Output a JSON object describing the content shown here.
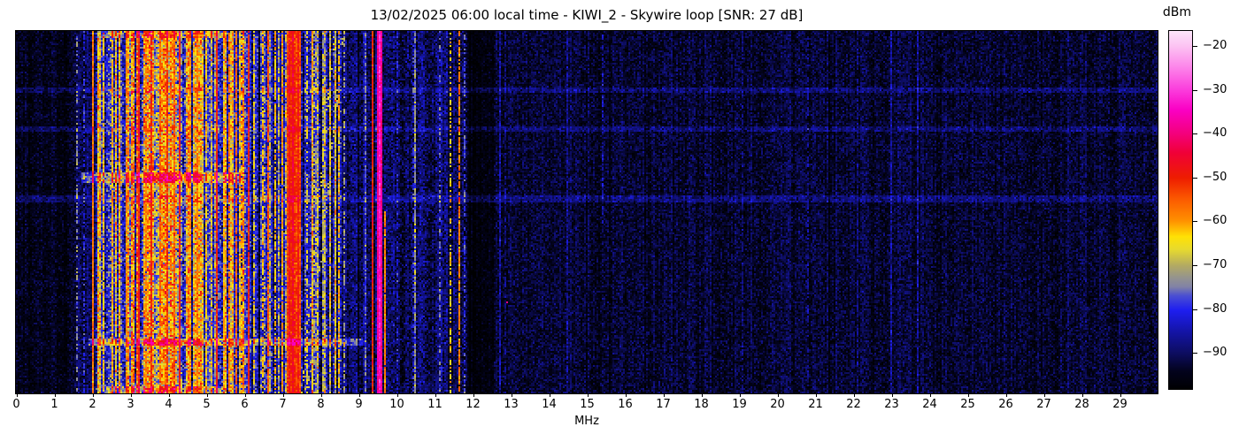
{
  "figure": {
    "background": "#ffffff",
    "text_color": "#000000"
  },
  "header": {
    "title": "13/02/2025 06:00 local time - KIWI_2 - Skywire loop [SNR: 27 dB]",
    "date": "13/02/2025",
    "time": "06:00 local time",
    "station": "KIWI_2",
    "antenna": "Skywire loop",
    "snr": "27 dB"
  },
  "x_axis": {
    "label": "MHz",
    "range_mhz": [
      0,
      30.02
    ],
    "ticks": [
      {
        "v": 0,
        "label": "0"
      },
      {
        "v": 1,
        "label": "1"
      },
      {
        "v": 2,
        "label": "2"
      },
      {
        "v": 3,
        "label": "3"
      },
      {
        "v": 4,
        "label": "4"
      },
      {
        "v": 5,
        "label": "5"
      },
      {
        "v": 6,
        "label": "6"
      },
      {
        "v": 7,
        "label": "7"
      },
      {
        "v": 8,
        "label": "8"
      },
      {
        "v": 9,
        "label": "9"
      },
      {
        "v": 10,
        "label": "10"
      },
      {
        "v": 11,
        "label": "11"
      },
      {
        "v": 12,
        "label": "12"
      },
      {
        "v": 13,
        "label": "13"
      },
      {
        "v": 14,
        "label": "14"
      },
      {
        "v": 15,
        "label": "15"
      },
      {
        "v": 16,
        "label": "16"
      },
      {
        "v": 17,
        "label": "17"
      },
      {
        "v": 18,
        "label": "18"
      },
      {
        "v": 19,
        "label": "19"
      },
      {
        "v": 20,
        "label": "20"
      },
      {
        "v": 21,
        "label": "21"
      },
      {
        "v": 22,
        "label": "22"
      },
      {
        "v": 23,
        "label": "23"
      },
      {
        "v": 24,
        "label": "24"
      },
      {
        "v": 25,
        "label": "25"
      },
      {
        "v": 26,
        "label": "26"
      },
      {
        "v": 27,
        "label": "27"
      },
      {
        "v": 28,
        "label": "28"
      },
      {
        "v": 29,
        "label": "29"
      }
    ]
  },
  "colorbar": {
    "label": "dBm",
    "vmin": -98.2,
    "vmax": -16.6,
    "ticks": [
      {
        "v": -20,
        "label": "−20"
      },
      {
        "v": -30,
        "label": "−30"
      },
      {
        "v": -40,
        "label": "−40"
      },
      {
        "v": -50,
        "label": "−50"
      },
      {
        "v": -60,
        "label": "−60"
      },
      {
        "v": -70,
        "label": "−70"
      },
      {
        "v": -80,
        "label": "−80"
      },
      {
        "v": -90,
        "label": "−90"
      }
    ]
  },
  "chart_data": {
    "type": "heatmap",
    "title": "13/02/2025 06:00 local time - KIWI_2 - Skywire loop [SNR: 27 dB]",
    "xlabel": "MHz",
    "x_range_mhz": [
      0,
      30.02
    ],
    "y_axis": "time (waterfall rows, unlabeled)",
    "value_unit": "dBm",
    "value_range_dbm": [
      -98.2,
      -16.6
    ],
    "grid": false,
    "legend": "colorbar right, dBm −20 to −90",
    "colormap_stops": [
      [
        0.0,
        "#000002"
      ],
      [
        0.05,
        "#03031d"
      ],
      [
        0.1,
        "#0d0d60"
      ],
      [
        0.16,
        "#1414a6"
      ],
      [
        0.22,
        "#1e1ef0"
      ],
      [
        0.26,
        "#4a4ed2"
      ],
      [
        0.285,
        "#8182a6"
      ],
      [
        0.31,
        "#94938f"
      ],
      [
        0.345,
        "#b3aa62"
      ],
      [
        0.39,
        "#e7da2e"
      ],
      [
        0.425,
        "#ffe105"
      ],
      [
        0.47,
        "#ff9000"
      ],
      [
        0.53,
        "#fb5a00"
      ],
      [
        0.59,
        "#ee1c00"
      ],
      [
        0.66,
        "#f00038"
      ],
      [
        0.715,
        "#f4007e"
      ],
      [
        0.78,
        "#fa00c4"
      ],
      [
        0.835,
        "#fb3cdc"
      ],
      [
        0.9,
        "#fc86ea"
      ],
      [
        0.955,
        "#fcc0f2"
      ],
      [
        1.0,
        "#fde6fa"
      ]
    ],
    "band_format": [
      "f0_mhz",
      "f1_mhz",
      "mean_dbm",
      "col_sd",
      "px_sd",
      "hot_prob",
      "hot_mean_dbm",
      "hot_sd"
    ],
    "noise_bands": [
      [
        0.0,
        1.5,
        -95.0,
        1.0,
        2.2,
        0,
        0,
        0
      ],
      [
        1.5,
        2.05,
        -92.0,
        2.0,
        3.0,
        0.1,
        -80,
        4
      ],
      [
        2.05,
        3.0,
        -80.0,
        4.0,
        5.0,
        0.45,
        -67,
        5
      ],
      [
        3.0,
        4.6,
        -76.0,
        5.0,
        5.5,
        0.65,
        -62,
        6
      ],
      [
        4.6,
        5.55,
        -79.0,
        4.0,
        5.0,
        0.5,
        -65,
        5
      ],
      [
        5.55,
        8.55,
        -85.0,
        4.5,
        4.5,
        0.27,
        -68,
        5
      ],
      [
        8.55,
        11.85,
        -90.5,
        2.5,
        3.5,
        0.05,
        -76,
        3
      ],
      [
        11.85,
        12.55,
        -96.5,
        1.0,
        1.8,
        0,
        0,
        0
      ],
      [
        12.55,
        30.1,
        -93.2,
        1.2,
        2.6,
        0.012,
        -88,
        2
      ]
    ],
    "line_format": [
      "freq_mhz",
      "level_dbm",
      "dash_fraction",
      "halfwidth_cells",
      "y_start_frac",
      "y_end_frac"
    ],
    "signal_lines": [
      [
        1.56,
        -74,
        0.5,
        0,
        0,
        1
      ],
      [
        1.78,
        -80,
        0.5,
        0,
        0,
        1
      ],
      [
        2.0,
        -57,
        1,
        0,
        0,
        1
      ],
      [
        2.3,
        -63,
        0.8,
        0,
        0,
        1
      ],
      [
        2.5,
        -61,
        0.9,
        0,
        0,
        1
      ],
      [
        2.72,
        -64,
        0.7,
        0,
        0,
        1
      ],
      [
        2.9,
        -59,
        0.9,
        0,
        0,
        1
      ],
      [
        3.2,
        -52,
        0.95,
        0,
        0,
        1
      ],
      [
        3.4,
        -58,
        0.9,
        0,
        0,
        1
      ],
      [
        3.55,
        -50,
        0.95,
        0,
        0,
        1
      ],
      [
        3.75,
        -55,
        0.9,
        0,
        0,
        1
      ],
      [
        3.95,
        -52,
        0.95,
        0,
        0,
        1
      ],
      [
        4.15,
        -57,
        0.9,
        0,
        0,
        1
      ],
      [
        4.3,
        -50,
        0.95,
        0,
        0,
        1
      ],
      [
        4.55,
        -60,
        0.85,
        0,
        0,
        1
      ],
      [
        4.75,
        -58,
        0.9,
        0,
        0,
        1
      ],
      [
        5.0,
        -63,
        0.8,
        0,
        0,
        1
      ],
      [
        5.28,
        -50,
        0.95,
        0,
        0,
        1
      ],
      [
        5.45,
        -62,
        0.8,
        0,
        0,
        1
      ],
      [
        5.6,
        -58,
        0.85,
        0,
        0,
        1
      ],
      [
        5.75,
        -56,
        0.9,
        0,
        0,
        1
      ],
      [
        5.9,
        -61,
        0.7,
        0,
        0,
        1
      ],
      [
        6.1,
        -50,
        0.95,
        0,
        0,
        1
      ],
      [
        6.25,
        -64,
        0.6,
        0,
        0,
        1
      ],
      [
        6.45,
        -62,
        0.7,
        0,
        0,
        1
      ],
      [
        6.6,
        -54,
        0.9,
        0,
        0,
        1
      ],
      [
        6.8,
        -62,
        0.8,
        0,
        0,
        1
      ],
      [
        7.0,
        -60,
        0.85,
        0,
        0,
        1
      ],
      [
        7.15,
        -48,
        1,
        1,
        0,
        1
      ],
      [
        7.27,
        -46,
        1,
        1,
        0,
        1
      ],
      [
        7.39,
        -49,
        1,
        1,
        0,
        1
      ],
      [
        7.62,
        -66,
        0.5,
        0,
        0,
        1
      ],
      [
        7.82,
        -70,
        0.4,
        0,
        0,
        1
      ],
      [
        8.05,
        -68,
        0.4,
        0,
        0,
        1
      ],
      [
        8.45,
        -62,
        0.7,
        0,
        0,
        1
      ],
      [
        8.62,
        -72,
        0.5,
        0,
        0,
        1
      ],
      [
        9.35,
        -50,
        1,
        0,
        0,
        1
      ],
      [
        9.55,
        -33,
        1,
        1,
        0,
        1
      ],
      [
        9.68,
        -58,
        0.95,
        0,
        0.5,
        1
      ],
      [
        10.0,
        -82,
        0.5,
        0,
        0,
        1
      ],
      [
        10.42,
        -80,
        0.5,
        0,
        0,
        1
      ],
      [
        11.12,
        -76,
        0.4,
        0,
        0,
        1
      ],
      [
        11.4,
        -64,
        0.55,
        0,
        0,
        1
      ],
      [
        11.62,
        -58,
        0.85,
        0,
        0,
        1
      ],
      [
        11.76,
        -78,
        0.5,
        0,
        0,
        1
      ],
      [
        12.86,
        -87,
        0.4,
        0,
        0,
        1
      ],
      [
        15.4,
        -84,
        0.5,
        0,
        0,
        0.55
      ],
      [
        19.1,
        -88,
        0.6,
        0,
        0,
        1
      ],
      [
        20.8,
        -87,
        0.6,
        0,
        0,
        1
      ],
      [
        23.2,
        -89,
        0.5,
        0,
        0,
        1
      ]
    ],
    "streak_format": [
      "y0_frac",
      "y1_frac",
      "f0_mhz",
      "f1_mhz",
      "boost_db"
    ],
    "horizontal_streaks": [
      [
        0.0,
        0.015,
        2.3,
        5.6,
        9
      ],
      [
        0.158,
        0.168,
        0,
        30.1,
        4.5
      ],
      [
        0.268,
        0.278,
        0,
        30.1,
        4.5
      ],
      [
        0.395,
        0.418,
        1.7,
        5.9,
        13
      ],
      [
        0.399,
        0.414,
        3.5,
        4.9,
        8
      ],
      [
        0.458,
        0.47,
        0,
        30.1,
        5
      ],
      [
        0.852,
        0.868,
        1.9,
        9.1,
        12
      ],
      [
        0.855,
        0.866,
        3.3,
        4.7,
        9
      ],
      [
        0.982,
        1.0,
        2.35,
        5.5,
        10
      ]
    ],
    "diagonal_streaks": [
      {
        "f_top_mhz": 8.35,
        "f_bottom_mhz": 7.5,
        "level_dbm": -66,
        "dash_fraction": 0.4
      },
      {
        "f_top_mhz": 8.6,
        "f_bottom_mhz": 7.65,
        "level_dbm": -70,
        "dash_fraction": 0.3
      }
    ],
    "dots": [
      {
        "f_mhz": 12.87,
        "y_frac": 0.75,
        "level_dbm": -40
      }
    ]
  }
}
